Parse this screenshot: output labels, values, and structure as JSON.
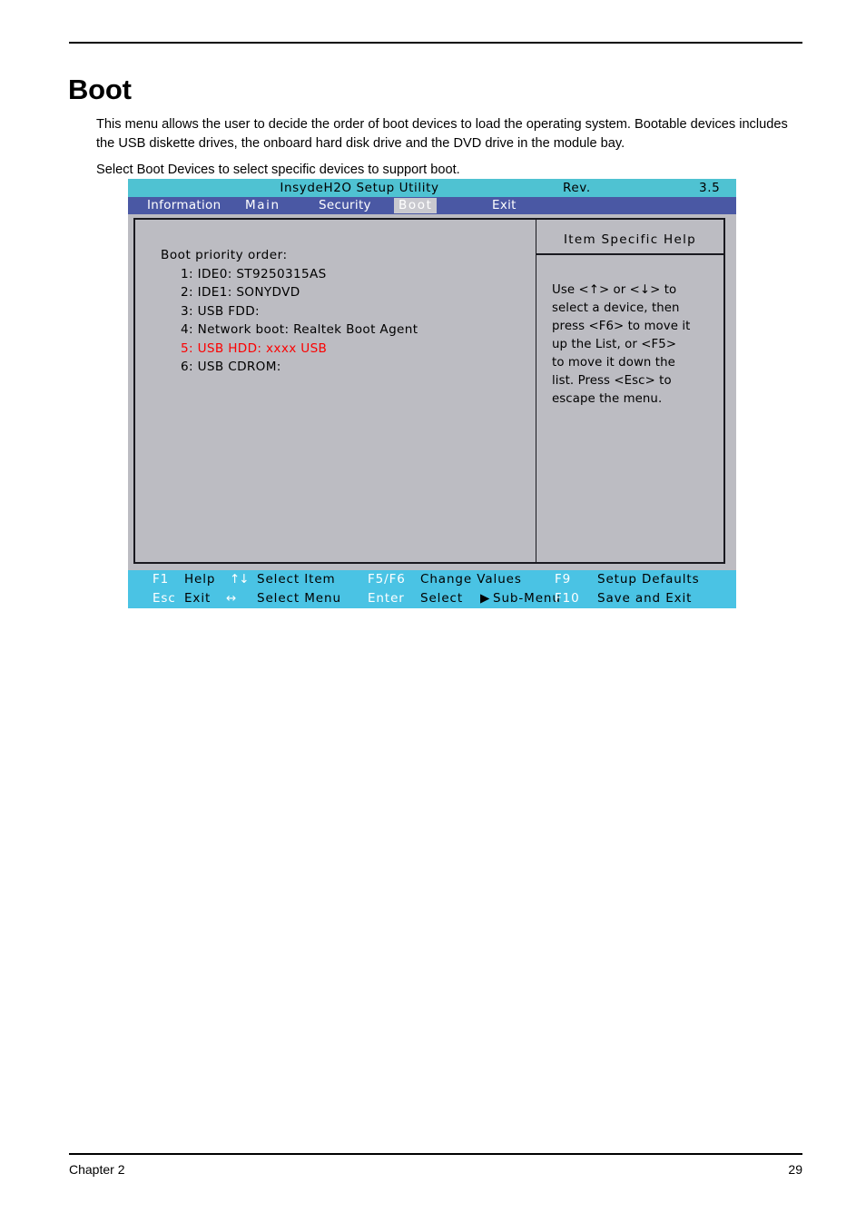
{
  "document": {
    "title": "Boot",
    "paragraphs": [
      "This menu allows the user to decide the order of boot devices to load the operating system. Bootable devices includes the USB diskette drives, the onboard hard disk drive and the DVD drive in the module bay.",
      "Select Boot Devices to select specific devices to support boot."
    ],
    "footer": {
      "chapter": "Chapter 2",
      "page_number": "29"
    }
  },
  "bios": {
    "titlebar": {
      "utility_name": "InsydeH2O Setup Utility",
      "rev_label": "Rev.",
      "rev_value": "3.5",
      "background_color": "#4FC2D2"
    },
    "menubar": {
      "background_color": "#4A58A4",
      "active_tab_background": "#C9C9CF",
      "tabs": [
        {
          "label": "Information",
          "active": false
        },
        {
          "label": "Main",
          "active": false
        },
        {
          "label": "Security",
          "active": false
        },
        {
          "label": "Boot",
          "active": true
        },
        {
          "label": "Exit",
          "active": false
        }
      ]
    },
    "main_panel": {
      "background_color": "#BCBCC2",
      "heading": "Boot priority order:",
      "entries": [
        {
          "label": "1: IDE0: ST9250315AS",
          "highlighted": false
        },
        {
          "label": "2: IDE1: SONYDVD",
          "highlighted": false
        },
        {
          "label": "3: USB FDD:",
          "highlighted": false
        },
        {
          "label": "4: Network boot: Realtek Boot Agent",
          "highlighted": false
        },
        {
          "label": "5: USB HDD: xxxx USB",
          "highlighted": true
        },
        {
          "label": "6: USB CDROM:",
          "highlighted": false
        }
      ],
      "highlight_color": "#FB0000"
    },
    "help_panel": {
      "title": "Item Specific Help",
      "lines": [
        "Use <↑> or <↓> to",
        "select a device, then",
        "press <F6> to move it",
        "up the List, or <F5>",
        "to move it down the",
        "list. Press <Esc> to",
        "escape the menu."
      ]
    },
    "footer_bar": {
      "background_color": "#4AC3E4",
      "row1": {
        "key1": "F1",
        "text1": "Help",
        "arrow1": "↑↓",
        "text2": "Select Item",
        "key2": "F5/F6",
        "text3": "Change Values",
        "key3": "F9",
        "text4": "Setup Defaults"
      },
      "row2": {
        "key1": "Esc",
        "text1": "Exit",
        "arrow1": "↔",
        "text2": "Select Menu",
        "key2": "Enter",
        "text3": "Select",
        "triangle": "▶",
        "text3b": "Sub-Menu",
        "key3": "F10",
        "text4": "Save and Exit"
      }
    }
  }
}
